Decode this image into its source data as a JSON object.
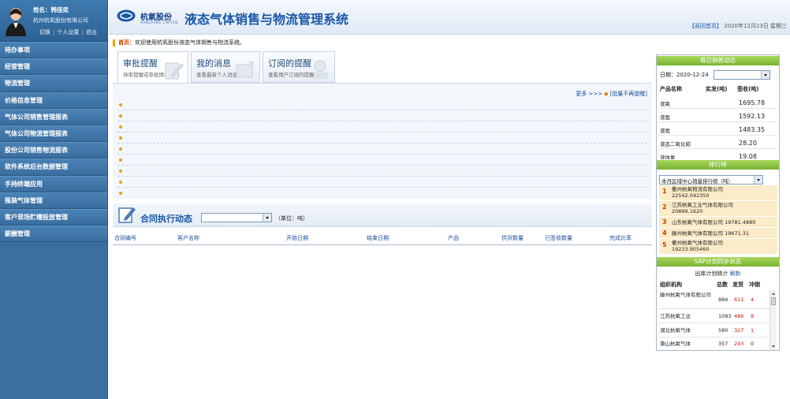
{
  "user": {
    "name_label": "姓名：韩佳奕",
    "company": "杭州杭氧股份有限公司",
    "links": [
      "切换",
      "个人设置",
      "退出"
    ]
  },
  "menu": [
    "待办事项",
    "经营管理",
    "物流管理",
    "价格信息管理",
    "气体公司销售管理报表",
    "气体公司物流管理报表",
    "股份公司销售物流报表",
    "软件系统后台数据管理",
    "手持终端应用",
    "瓶装气体管理",
    "客户现场贮槽投放管理",
    "薪酬管理"
  ],
  "header": {
    "brand": "杭氧股份",
    "brand_en": "HANGYANG LIMITED",
    "title": "液态气体销售与物流管理系统",
    "return_home": "【返回首页】",
    "date": "2020年12月23日 星期三"
  },
  "breadcrumb": {
    "home": "首页：",
    "text": "欢迎使用杭氧股份液态气体销售与物流系统。"
  },
  "tabs": [
    {
      "title": "审批提醒",
      "subtitle": "待审提醒或审批情况反馈"
    },
    {
      "title": "我的消息",
      "subtitle": "查看最新个人消息"
    },
    {
      "title": "订阅的提醒",
      "subtitle": "查看用户订阅的提醒"
    }
  ],
  "reminders": {
    "more": "更多 >>>",
    "batch": "[批量不再提醒]",
    "row_count": 9
  },
  "contract": {
    "title": "合同执行动态",
    "select_value": "",
    "unit": "（单位：吨）",
    "columns": [
      "合同编号",
      "客户名称",
      "开始日期",
      "结束日期",
      "产品",
      "供货数量",
      "已签收数量",
      "完成比率"
    ]
  },
  "daily_sales": {
    "title": "每日销售动态",
    "date_label": "日期：2020-12-24",
    "date_select": "",
    "headers": [
      "产品名称",
      "实发(吨)",
      "签收(吨)"
    ],
    "rows": [
      {
        "product": "液氧",
        "signed": "1695.78"
      },
      {
        "product": "液氩",
        "signed": "1592.13"
      },
      {
        "product": "液氮",
        "signed": "1483.35"
      },
      {
        "product": "液态二氧化碳",
        "signed": "28.20"
      },
      {
        "product": "液体氧",
        "signed": "19.08"
      }
    ]
  },
  "ranking": {
    "title": "排行榜",
    "select": "本月区域中心销量排行榜（吨）",
    "items": [
      {
        "rank": "1",
        "line1": "衢州杭氧物流有限公司",
        "line2": "22542.042350"
      },
      {
        "rank": "2",
        "line1": "江苏杭氧工业气体有限公司",
        "line2": "20899.1620"
      },
      {
        "rank": "3",
        "line1": "山东杭氧气体有限公司 19781.4880",
        "line2": ""
      },
      {
        "rank": "4",
        "line1": "滕州杭氧气体有限公司 19671.31",
        "line2": ""
      },
      {
        "rank": "5",
        "line1": "衢州杭氧气体有限公司",
        "line2": "19233.905460"
      }
    ]
  },
  "sap": {
    "title": "SAP计划同步状态",
    "subtitle": "出库计划统计",
    "refresh": "刷新",
    "headers": [
      "组织机构",
      "总数",
      "发货",
      "冲销"
    ],
    "rows": [
      {
        "org": "滕州杭氧气体有限公司",
        "total": "884",
        "shipped": "611",
        "reversed": "4"
      },
      {
        "org": "江苏杭氧工业",
        "total": "1093",
        "shipped": "486",
        "reversed": "8"
      },
      {
        "org": "湖北杭氧气体",
        "total": "580",
        "shipped": "327",
        "reversed": "1"
      },
      {
        "org": "萧山杭氧气体",
        "total": "357",
        "shipped": "293",
        "reversed": "0"
      }
    ]
  },
  "colors": {
    "sidebar": "#3b6f9f",
    "accent_green": "#7ab431",
    "title_blue": "#1a57a8",
    "alert_red": "#d41010"
  }
}
